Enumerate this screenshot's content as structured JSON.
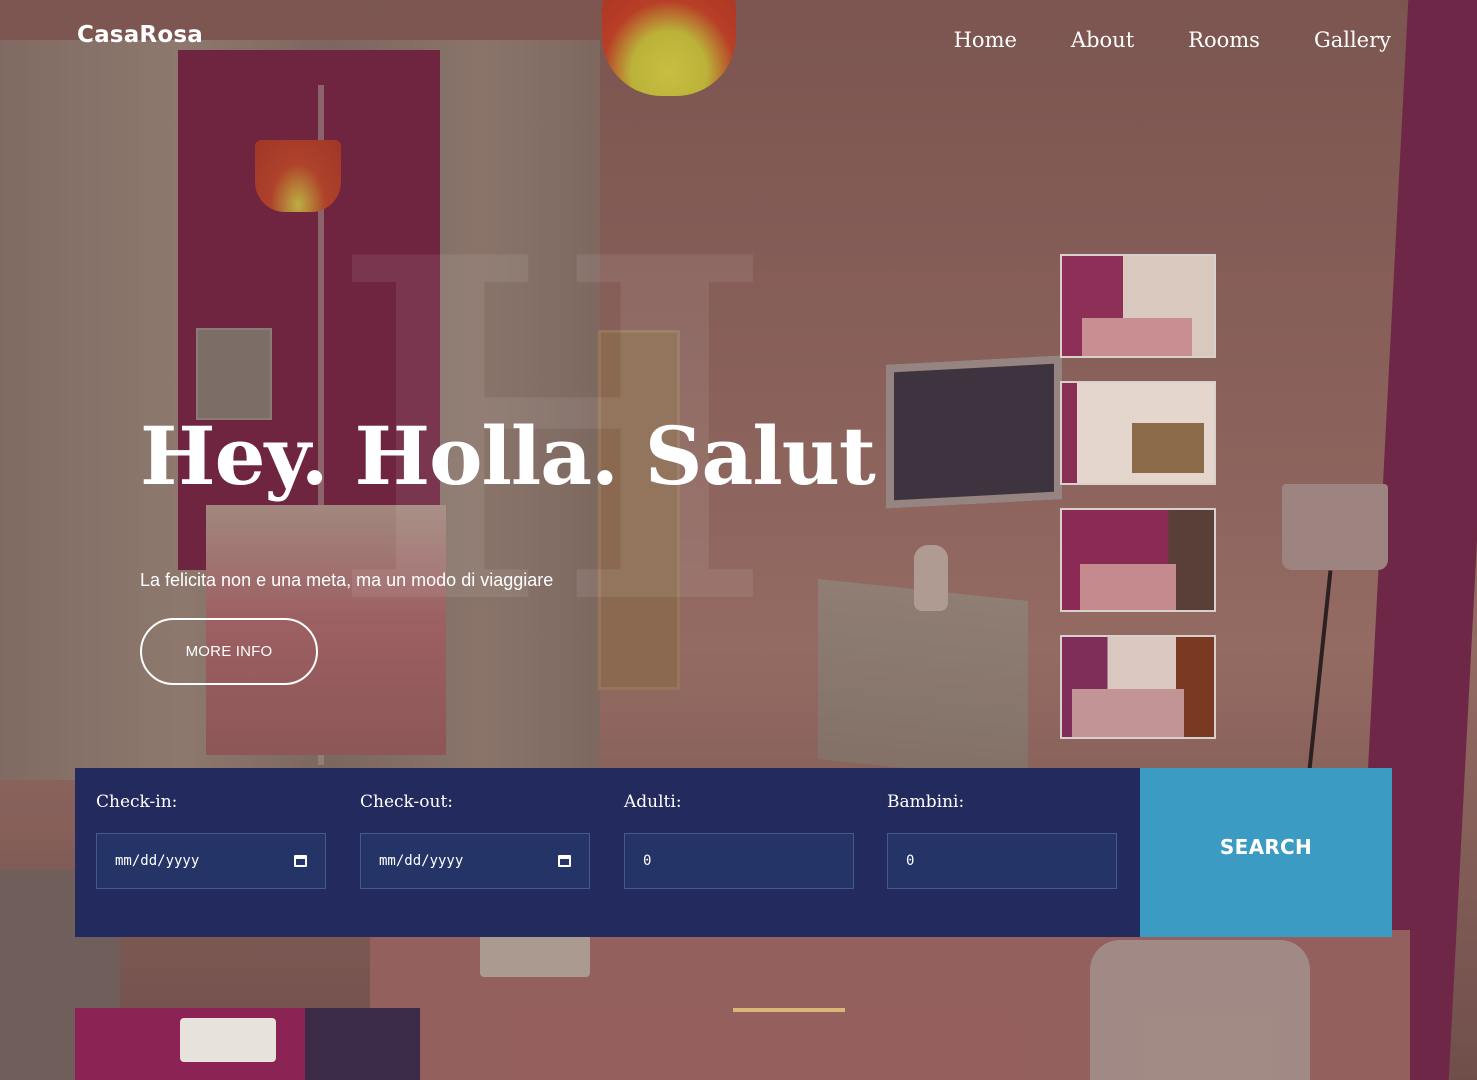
{
  "brand": {
    "name": "CasaRosa"
  },
  "nav": {
    "items": [
      "Home",
      "About",
      "Rooms",
      "Gallery"
    ]
  },
  "hero": {
    "title": "Hey. Holla. Salut",
    "subtitle": "La felicita non e una meta, ma un modo di viaggiare",
    "cta_label": "MORE INFO",
    "watermark": "H"
  },
  "booking": {
    "checkin": {
      "label": "Check-in:",
      "value": "mm/dd/yyyy"
    },
    "checkout": {
      "label": "Check-out:",
      "value": "mm/dd/yyyy"
    },
    "adults": {
      "label": "Adulti:",
      "value": "0"
    },
    "children": {
      "label": "Bambini:",
      "value": "0"
    },
    "search_label": "SEARCH"
  },
  "colors": {
    "booking_bg": "#232b5e",
    "input_bg": "#243467",
    "search_bg": "#3b9bc3",
    "accent_rule": "#d8b874"
  },
  "thumbnails": [
    {
      "icon": "room-photo"
    },
    {
      "icon": "room-photo"
    },
    {
      "icon": "room-photo"
    },
    {
      "icon": "room-photo"
    }
  ]
}
